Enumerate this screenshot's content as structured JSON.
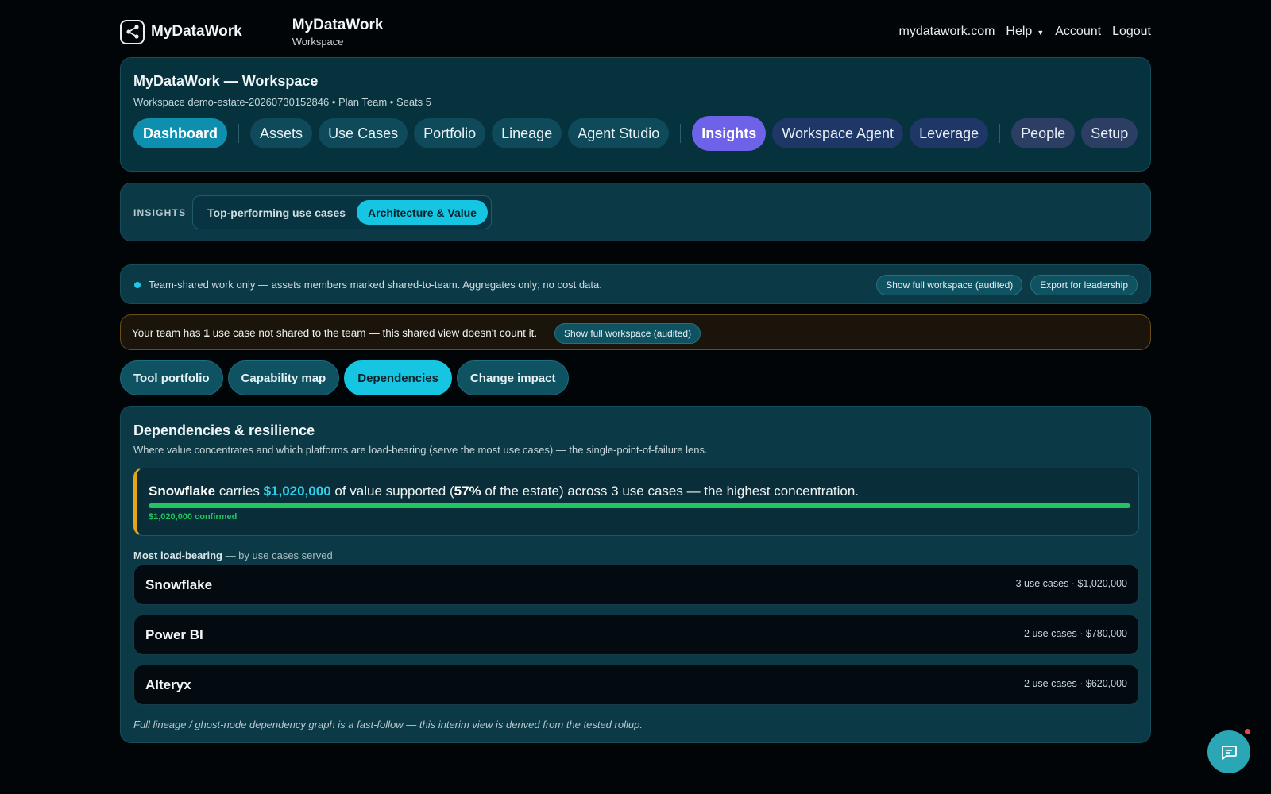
{
  "header": {
    "logo_name": "MyDataWork",
    "workspace_title": "MyDataWork",
    "workspace_subtitle": "Workspace",
    "nav": {
      "site_link": "mydatawork.com",
      "help": "Help",
      "account": "Account",
      "logout": "Logout"
    }
  },
  "workspace_card": {
    "title": "MyDataWork — Workspace",
    "meta": "Workspace demo-estate-20260730152846 • Plan Team • Seats 5",
    "nav_items": {
      "dashboard": "Dashboard",
      "assets": "Assets",
      "use_cases": "Use Cases",
      "portfolio": "Portfolio",
      "lineage": "Lineage",
      "agent_studio": "Agent Studio",
      "insights": "Insights",
      "workspace_agent": "Workspace Agent",
      "leverage": "Leverage",
      "people": "People",
      "setup": "Setup"
    }
  },
  "insights_bar": {
    "label": "INSIGHTS",
    "segments": {
      "top_performing": "Top-performing use cases",
      "architecture_value": "Architecture & Value"
    }
  },
  "scope_notice": {
    "text": "Team-shared work only — assets members marked shared-to-team. Aggregates only; no cost data.",
    "show_full": "Show full workspace (audited)",
    "export": "Export for leadership"
  },
  "warning": {
    "prefix": "Your team has ",
    "count": "1",
    "suffix": " use case not shared to the team — this shared view doesn't count it.",
    "button": "Show full workspace (audited)"
  },
  "tabs": {
    "tool_portfolio": "Tool portfolio",
    "capability_map": "Capability map",
    "dependencies": "Dependencies",
    "change_impact": "Change impact"
  },
  "dependencies": {
    "title": "Dependencies & resilience",
    "subtitle": "Where value concentrates and which platforms are load-bearing (serve the most use cases) — the single-point-of-failure lens.",
    "highlight": {
      "platform": "Snowflake",
      "carries": " carries ",
      "value": "$1,020,000",
      "of_value": " of value supported (",
      "percent": "57%",
      "rest": " of the estate) across 3 use cases — the highest concentration.",
      "confirmed_share": 1.0,
      "confirmed_label": "$1,020,000 confirmed"
    },
    "load_bearing_label": "Most load-bearing",
    "load_bearing_suffix": " — by use cases served",
    "platforms": [
      {
        "name": "Snowflake",
        "meta": "3 use cases · $1,020,000"
      },
      {
        "name": "Power BI",
        "meta": "2 use cases · $780,000"
      },
      {
        "name": "Alteryx",
        "meta": "2 use cases · $620,000"
      }
    ],
    "footnote": "Full lineage / ghost-node dependency graph is a fast-follow — this interim view is derived from the tested rollup."
  },
  "colors": {
    "accent": "#15c5e2",
    "insights": "#6d62e8",
    "success": "#22c55e",
    "warning_border": "#e3a51e"
  }
}
